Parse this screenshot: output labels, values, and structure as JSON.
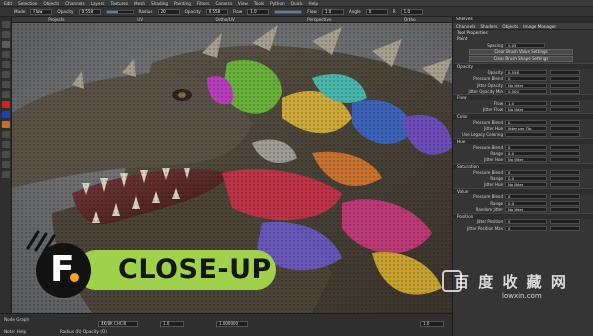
{
  "menubar": {
    "items": [
      "Edit",
      "Selection",
      "Objects",
      "Channels",
      "Layers",
      "Textures",
      "Mesh",
      "Shading",
      "Painting",
      "Filters",
      "Camera",
      "View",
      "Tools",
      "Python",
      "Quick",
      "Help"
    ]
  },
  "toolbar": {
    "mode_label": "Mode",
    "mode_value": "Flow",
    "opacity_label": "Opacity",
    "opacity_value": "0.558",
    "flow_label": "Flow",
    "flow_value": "1.0",
    "radius_label": "Radius",
    "radius_value": "20",
    "opacity2_value": "0.558",
    "flow2_value": "1.0",
    "angle_label": "Angle",
    "angle_value": "0",
    "fb_label": "R",
    "fb_value": "1.0",
    "fraction": 0.45
  },
  "viewport_tabs": [
    "Projects",
    "UV",
    "Ortho/UV",
    "Perspective",
    "Ortho"
  ],
  "bottombar": {
    "label1": "Node Graph",
    "coord_x": "1.0",
    "coord_y": "1.000000",
    "size_field": "1.0",
    "resolution": "4K/8K CHCIII",
    "fields_left": "Note: Help",
    "status": "Radius (R)  Opacity (O)"
  },
  "rightpanel": {
    "header": "Shelves",
    "tabs": [
      "Channels",
      "Shaders",
      "Objects",
      "Image Manager"
    ],
    "section_title": "Tool Properties",
    "paint_label": "Paint",
    "spacing_label": "Spacing",
    "spacing_value": "0.05",
    "btn1": "Clear Brush Value Settings",
    "btn2": "Clear Brush Shape Settings",
    "sections": [
      {
        "name": "Opacity",
        "rows": [
          {
            "label": "Opacity",
            "value": "0.558"
          },
          {
            "label": "Pressure Blend",
            "value": "0"
          },
          {
            "label": "Jitter Opacity",
            "value": "No Jitter"
          },
          {
            "label": "Jitter Opacity Min",
            "value": "0.000"
          }
        ]
      },
      {
        "name": "Flow",
        "rows": [
          {
            "label": "Flow",
            "value": "1.0"
          },
          {
            "label": "Jitter Flow",
            "value": "No Jitter"
          }
        ]
      },
      {
        "name": "Color",
        "rows": [
          {
            "label": "Pressure Blend",
            "value": "0"
          },
          {
            "label": "Jitter Hue",
            "value": "Jitter per Tip"
          },
          {
            "label": "Use Legacy Coloring",
            "value": ""
          }
        ]
      },
      {
        "name": "Hue",
        "rows": [
          {
            "label": "Pressure Blend",
            "value": "0"
          },
          {
            "label": "Range",
            "value": "0.0"
          },
          {
            "label": "Jitter Hue",
            "value": "No Jitter"
          }
        ]
      },
      {
        "name": "Saturation",
        "rows": [
          {
            "label": "Pressure Blend",
            "value": "0"
          },
          {
            "label": "Range",
            "value": "0.0"
          },
          {
            "label": "Jitter Hue",
            "value": "No Jitter"
          }
        ]
      },
      {
        "name": "Value",
        "rows": [
          {
            "label": "Pressure Blend",
            "value": "0"
          },
          {
            "label": "Range",
            "value": "0.0"
          },
          {
            "label": "Random Jitter",
            "value": "No Jitter"
          }
        ]
      },
      {
        "name": "Position",
        "rows": [
          {
            "label": "Jitter Position",
            "value": "0"
          },
          {
            "label": "Jitter Position Max",
            "value": "0"
          }
        ]
      }
    ]
  },
  "badge": {
    "letter": "F",
    "text": "CLOSE-UP",
    "pill_color": "#9fd24a",
    "dot_color": "#f5a623"
  },
  "watermark": {
    "text": "百 度 收 藏 网",
    "url": "lowxin.com"
  },
  "colors": {
    "ui_bg": "#2b2b2b",
    "viewport_bg": "#6c6e70",
    "badge_pill": "#9fd24a"
  }
}
